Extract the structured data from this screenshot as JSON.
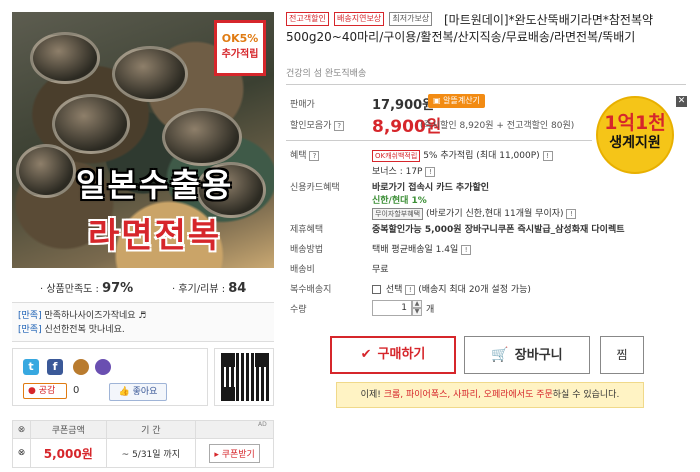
{
  "image": {
    "badge_line1": "OK5%",
    "badge_line2": "추가적립",
    "overlay_line1": "일본수출용",
    "overlay_line2": "라면전복"
  },
  "ratings": {
    "satisfaction_label": "· 상품만족도 :",
    "satisfaction_value": "97%",
    "review_label": "· 후기/리뷰 :",
    "review_value": "84"
  },
  "reviews": [
    {
      "tag": "[만족]",
      "text": "만족하나사이즈가작네요 ♬"
    },
    {
      "tag": "[만족]",
      "text": "신선한전복 맛나네요."
    }
  ],
  "share": {
    "twitter": "t",
    "facebook": "f",
    "gonggam": "공감",
    "gonggam_count": "0",
    "like": "좋아요"
  },
  "coupon": {
    "col_amount": "쿠폰금액",
    "col_period": "기 간",
    "amount": "5,000원",
    "period": "~ 5/31일 까지",
    "button": "쿠폰받기",
    "ad": "AD"
  },
  "product": {
    "badges": [
      "전고객할인",
      "배송지연보상",
      "최저가보상"
    ],
    "title": "[마트원데이]*완도산뚝배기라면*참전복약500g20~40마리/구이용/활전복/산지직송/무료배송/라면전복/뚝배기",
    "subtitle": "건강의 섬 완도직배송"
  },
  "price": {
    "label": "판매가",
    "value": "17,900원",
    "calc_button": "알뜰계산기",
    "discount_label": "할인모음가",
    "discount_value": "8,900원",
    "discount_detail": "(즉시할인 8,920원 + 전고객할인 80원)"
  },
  "promo": {
    "line1": "1억1천",
    "line2": "생계지원"
  },
  "benefits": {
    "label": "혜택",
    "ok_pill": "OK캐쉬백적립",
    "ok_text": "5% 추가적립 (최대 11,000P)",
    "bonus": "보너스 : 17P",
    "card_label": "신용카드혜택",
    "card_title": "바로가기 접속시 카드 추가할인",
    "card_brand": "신한/현대 1%",
    "installment_pill": "무이자할부혜택",
    "installment_text": "(바로가기 신한,현대 11개월 무이자)",
    "partner_label": "제휴혜택",
    "partner_text": "중복할인가능 5,000원 장바구니쿠폰 즉시발급_삼성화재 다이렉트",
    "shipping_method_label": "배송방법",
    "shipping_method": "택배 평균배송일 1.4일",
    "shipping_fee_label": "배송비",
    "shipping_fee": "무료",
    "multi_label": "복수배송지",
    "multi_option": "선택",
    "multi_note": "(배송지 최대 20개 설정 가능)",
    "qty_label": "수량",
    "qty_value": "1",
    "qty_unit": "개"
  },
  "actions": {
    "buy": "구매하기",
    "cart": "장바구니",
    "wish": "찜"
  },
  "notice": {
    "prefix": "이제",
    "browsers": "크롬, 파이어폭스, 사파리, 오페라에서도 주문",
    "suffix": "하실 수 있습니다."
  }
}
